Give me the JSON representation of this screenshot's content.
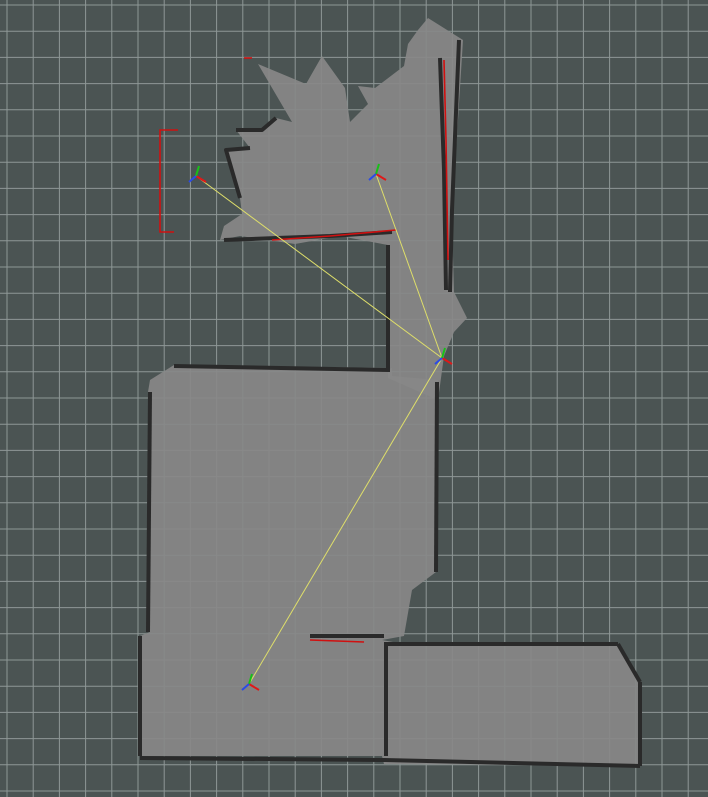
{
  "viewport": {
    "background_color": "#4b5453",
    "grid_color": "#8e9796",
    "free_space_color": "#888888",
    "obstacle_color": "#2a2a2a",
    "laser_scan_color": "#d01010",
    "pose_graph_edge_color": "#dede6a"
  },
  "frames": [
    {
      "id": "node-a",
      "label": "",
      "axes": {
        "x_color": "#e01818",
        "y_color": "#18c018",
        "z_color": "#2a4ae8"
      }
    },
    {
      "id": "node-b",
      "label": "",
      "axes": {
        "x_color": "#e01818",
        "y_color": "#18c018",
        "z_color": "#2a4ae8"
      }
    },
    {
      "id": "node-c",
      "label": "",
      "axes": {
        "x_color": "#e01818",
        "y_color": "#18c018",
        "z_color": "#2a4ae8"
      }
    },
    {
      "id": "node-d",
      "label": "",
      "axes": {
        "x_color": "#e01818",
        "y_color": "#18c018",
        "z_color": "#2a4ae8"
      }
    }
  ],
  "edges": [
    {
      "from": "node-a",
      "to": "node-c"
    },
    {
      "from": "node-b",
      "to": "node-c"
    },
    {
      "from": "node-c",
      "to": "node-d"
    }
  ]
}
